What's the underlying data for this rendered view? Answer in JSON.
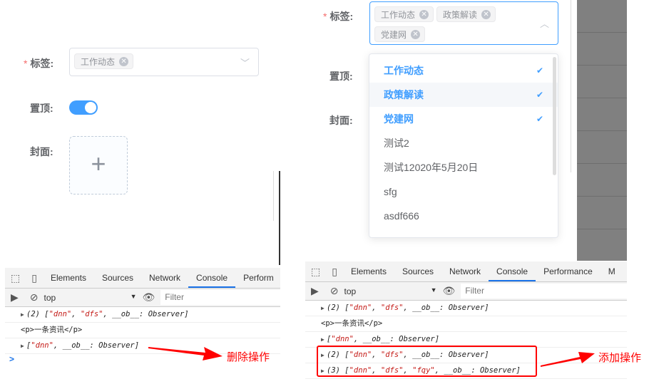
{
  "left": {
    "tags_label": "标签:",
    "top_label": "置顶:",
    "cover_label": "封面:",
    "selected_tags": [
      "工作动态"
    ],
    "toggle_on": true
  },
  "right": {
    "tags_label": "标签:",
    "top_label": "置顶:",
    "cover_label": "封面:",
    "selected_tags": [
      "工作动态",
      "政策解读",
      "党建网"
    ],
    "options": [
      {
        "label": "工作动态",
        "selected": true
      },
      {
        "label": "政策解读",
        "selected": true
      },
      {
        "label": "党建网",
        "selected": true
      },
      {
        "label": "测试2",
        "selected": false
      },
      {
        "label": "测试12020年5月20日",
        "selected": false
      },
      {
        "label": "sfg",
        "selected": false
      },
      {
        "label": "asdf666",
        "selected": false
      }
    ]
  },
  "devtools": {
    "tabs_left": [
      "Elements",
      "Sources",
      "Network",
      "Console",
      "Perform"
    ],
    "tabs_right": [
      "Elements",
      "Sources",
      "Network",
      "Console",
      "Performance",
      "M"
    ],
    "context": "top",
    "filter_placeholder": "Filter",
    "logs": {
      "l1": [
        "(2) [",
        "\"dnn\"",
        ", ",
        "\"dfs\"",
        ", __ob__: Observer]"
      ],
      "l2": "<p>一条资讯</p>",
      "l3": [
        "[",
        "\"dnn\"",
        ", __ob__: Observer]"
      ],
      "l4": [
        "(2) [",
        "\"dnn\"",
        ", ",
        "\"dfs\"",
        ", __ob__: Observer]"
      ],
      "l5": [
        "(3) [",
        "\"dnn\"",
        ", ",
        "\"dfs\"",
        ", ",
        "\"fqy\"",
        ", __ob__: Observer]"
      ]
    },
    "prompt": ">"
  },
  "annotations": {
    "delete": "删除操作",
    "add": "添加操作"
  },
  "colors": {
    "accent": "#409eff",
    "annotation": "#ff0000"
  }
}
